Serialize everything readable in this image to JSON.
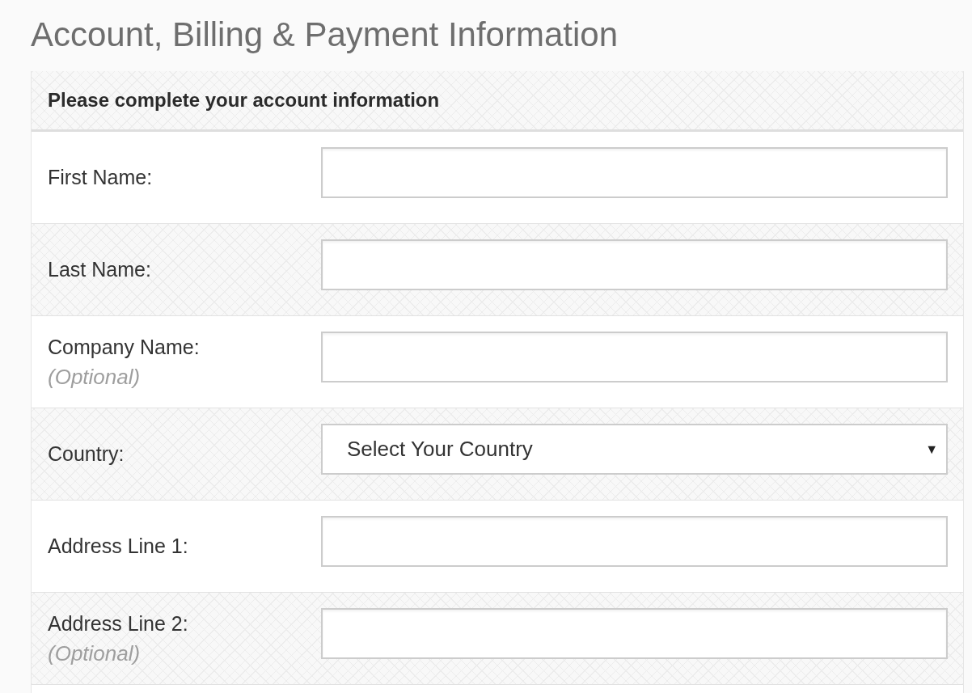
{
  "page": {
    "title": "Account, Billing & Payment Information"
  },
  "form": {
    "heading": "Please complete your account information",
    "fields": [
      {
        "kind": "text",
        "label": "First Name:"
      },
      {
        "kind": "text",
        "label": "Last Name:"
      },
      {
        "kind": "text",
        "label": "Company Name:",
        "note": "(Optional)"
      },
      {
        "kind": "select",
        "label": "Country:",
        "value": "Select Your Country",
        "arrow": "▼"
      },
      {
        "kind": "text",
        "label": "Address Line 1:"
      },
      {
        "kind": "text",
        "label": "Address Line 2:",
        "note": "(Optional)"
      }
    ]
  }
}
